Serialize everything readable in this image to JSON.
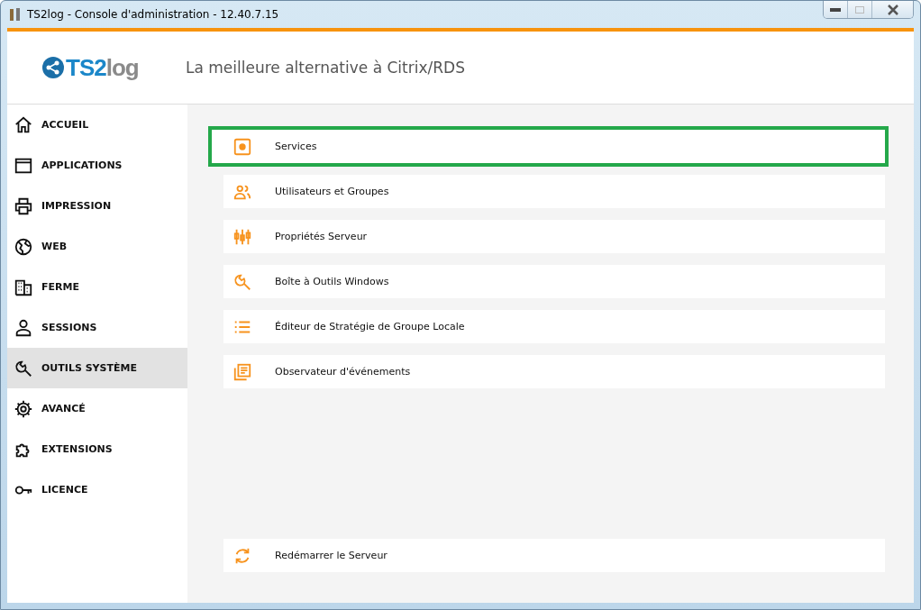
{
  "window": {
    "title": "TS2log - Console d'administration - 12.40.7.15",
    "maximize_disabled": true
  },
  "header": {
    "logo_text_a": "TS2",
    "logo_text_b": "log",
    "tagline": "La meilleure alternative à Citrix/RDS"
  },
  "sidebar": {
    "items": [
      {
        "label": "ACCUEIL",
        "kind": "home",
        "selected": false
      },
      {
        "label": "APPLICATIONS",
        "kind": "window",
        "selected": false
      },
      {
        "label": "IMPRESSION",
        "kind": "printer",
        "selected": false
      },
      {
        "label": "WEB",
        "kind": "globe",
        "selected": false
      },
      {
        "label": "FERME",
        "kind": "building",
        "selected": false
      },
      {
        "label": "SESSIONS",
        "kind": "person",
        "selected": false
      },
      {
        "label": "OUTILS SYSTÈME",
        "kind": "wrench",
        "selected": true
      },
      {
        "label": "AVANCÉ",
        "kind": "gear",
        "selected": false
      },
      {
        "label": "EXTENSIONS",
        "kind": "puzzle",
        "selected": false
      },
      {
        "label": "LICENCE",
        "kind": "key",
        "selected": false
      }
    ]
  },
  "tools": [
    {
      "label": "Services",
      "kind": "gearbox",
      "highlighted": true
    },
    {
      "label": "Utilisateurs et Groupes",
      "kind": "people",
      "highlighted": false
    },
    {
      "label": "Propriétés Serveur",
      "kind": "sliders",
      "highlighted": false
    },
    {
      "label": "Boîte à Outils Windows",
      "kind": "wrench",
      "highlighted": false
    },
    {
      "label": "Éditeur de Stratégie de Groupe Locale",
      "kind": "list",
      "highlighted": false
    },
    {
      "label": "Observateur d'événements",
      "kind": "doc",
      "highlighted": false
    }
  ],
  "footer_action": {
    "label": "Redémarrer le Serveur",
    "kind": "refresh"
  }
}
